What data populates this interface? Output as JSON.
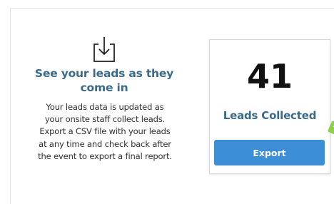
{
  "info": {
    "icon": "download-tray-icon",
    "title_line1": "See your leads as they",
    "title_line2": "come in",
    "body_lines": [
      "Your leads data is updated as",
      "your onsite staff collect leads.",
      "Export a CSV file with your leads",
      "at any time and check back after",
      "the event to export a final report."
    ]
  },
  "stat": {
    "count": "41",
    "label": "Leads Collected",
    "export_label": "Export"
  },
  "colors": {
    "heading": "#3a6a8a",
    "button": "#3c8fd6",
    "arrow": "#8fcf4a"
  }
}
